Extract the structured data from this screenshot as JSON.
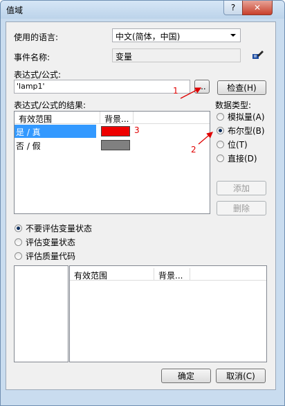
{
  "window": {
    "title": "值域",
    "help_label": "?",
    "close_label": "✕"
  },
  "language": {
    "label": "使用的语言:",
    "value": "中文(简体，中国)"
  },
  "event_name": {
    "label": "事件名称:",
    "value": "变量",
    "icon": "event-edit-icon"
  },
  "expression": {
    "label": "表达式/公式:",
    "value": "'lamp1'",
    "browse_label": "...",
    "check_label": "检查(H)"
  },
  "results": {
    "label": "表达式/公式的结果:",
    "columns": [
      "有效范围",
      "背景..."
    ],
    "rows": [
      {
        "range": "是 / 真",
        "color": "#ee0000",
        "selected": true
      },
      {
        "range": "否 / 假",
        "color": "#808080",
        "selected": false
      }
    ]
  },
  "data_type": {
    "label": "数据类型:",
    "options": [
      {
        "label": "模拟量(A)",
        "checked": false
      },
      {
        "label": "布尔型(B)",
        "checked": true
      },
      {
        "label": "位(T)",
        "checked": false
      },
      {
        "label": "直接(D)",
        "checked": false
      }
    ],
    "add_label": "添加",
    "delete_label": "删除"
  },
  "eval_mode": {
    "options": [
      {
        "label": "不要评估变量状态",
        "checked": true
      },
      {
        "label": "评估变量状态",
        "checked": false
      },
      {
        "label": "评估质量代码",
        "checked": false
      }
    ]
  },
  "bottom_table": {
    "columns": [
      "有效范围",
      "背景..."
    ]
  },
  "footer": {
    "ok_label": "确定",
    "cancel_label": "取消(C)"
  },
  "annotations": {
    "marker_1": "1",
    "marker_2": "2",
    "marker_3": "3",
    "color": "#e00000"
  }
}
